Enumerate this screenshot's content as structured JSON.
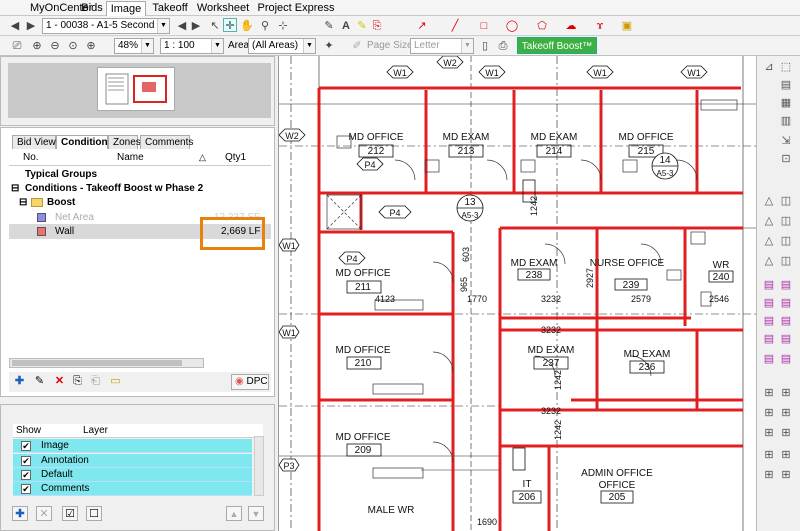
{
  "menu_tabs": [
    "MyOnCenter",
    "Bids",
    "Image",
    "Takeoff",
    "Worksheet",
    "Project Express"
  ],
  "page_selector": "1 - 00038 - A1-5 Second",
  "zoom": "48%",
  "scale": "1 : 100",
  "area_label": "Area",
  "area_value": "(All Areas)",
  "page_size_label": "Page Size",
  "page_size_value": "Letter",
  "takeoff_boost_label": "Takeoff Boost™",
  "panel_tabs": [
    "Bid View",
    "Conditions",
    "Zones",
    "Comments"
  ],
  "columns": {
    "no": "No.",
    "name": "Name",
    "qty": "Qty1"
  },
  "tree": {
    "typical_groups": "Typical Groups",
    "conditions_group": "Conditions - Takeoff Boost w Phase 2",
    "boost_folder": "Boost",
    "net_area": {
      "name": "Net Area",
      "qty": "12,237 SF"
    },
    "wall": {
      "name": "Wall",
      "qty": "2,669 LF"
    }
  },
  "dpc_label": "DPC",
  "layers": {
    "show_header": "Show",
    "layer_header": "Layer",
    "items": [
      "Image",
      "Annotation",
      "Default",
      "Comments"
    ]
  },
  "colors": {
    "highlight": "#e8820c",
    "wall_red": "#e02020",
    "layer_row": "#7fe8ee",
    "boost_green": "#3cb043"
  },
  "drawing": {
    "rooms": [
      {
        "name": "MD OFFICE",
        "num": "212"
      },
      {
        "name": "MD EXAM",
        "num": "213"
      },
      {
        "name": "MD EXAM",
        "num": "214"
      },
      {
        "name": "MD OFFICE",
        "num": "215"
      },
      {
        "name": "MD OFFICE",
        "num": "211"
      },
      {
        "name": "MD OFFICE",
        "num": "210"
      },
      {
        "name": "MD OFFICE",
        "num": "209"
      },
      {
        "name": "MD EXAM",
        "num": "238"
      },
      {
        "name": "NURSE OFFICE",
        "num": "239"
      },
      {
        "name": "WR",
        "num": "240"
      },
      {
        "name": "MD EXAM",
        "num": "237"
      },
      {
        "name": "MD EXAM",
        "num": "236"
      },
      {
        "name": "IT",
        "num": "206"
      },
      {
        "name": "ADMIN OFFICE",
        "num": "205"
      },
      {
        "name": "MALE WR",
        "num": ""
      }
    ],
    "tags": [
      "W1",
      "W2",
      "W1",
      "W1",
      "W1",
      "W2",
      "W1",
      "W1",
      "P4",
      "P4",
      "P4",
      "P3"
    ],
    "section_marks": [
      {
        "num": "14",
        "sheet": "A5-3"
      },
      {
        "num": "13",
        "sheet": "A5-3"
      }
    ],
    "dims": [
      "4123",
      "3232",
      "2579",
      "2546",
      "1770",
      "965",
      "603",
      "1242",
      "2927",
      "1690",
      "3232",
      "3232",
      "1242",
      "1242"
    ]
  }
}
